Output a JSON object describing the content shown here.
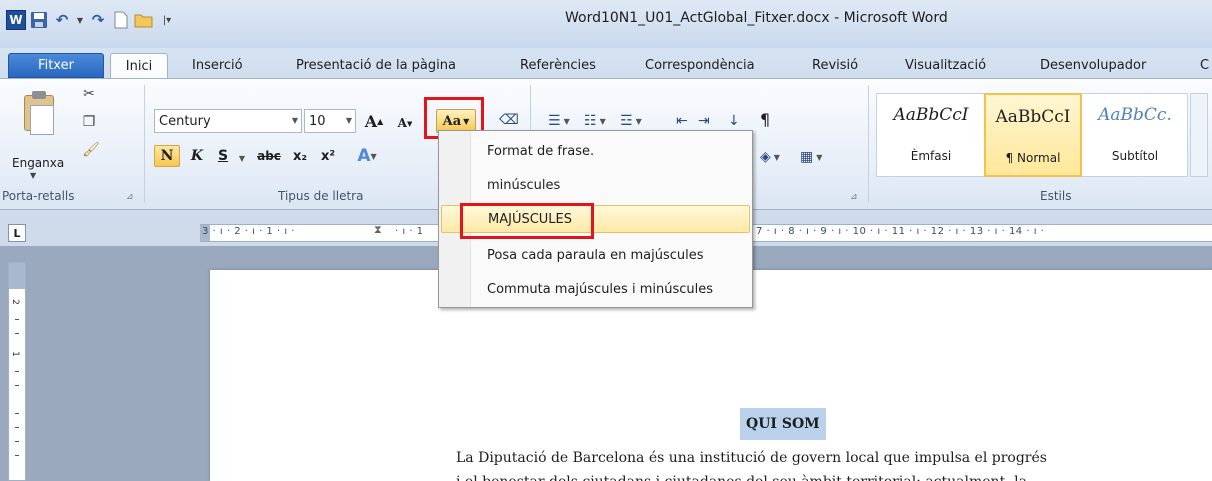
{
  "title_bar": {
    "title": "Word10N1_U01_ActGlobal_Fitxer.docx - Microsoft Word",
    "app_icon": "W"
  },
  "tabs": [
    {
      "label": "Fitxer"
    },
    {
      "label": "Inici"
    },
    {
      "label": "Inserció"
    },
    {
      "label": "Presentació de la pàgina"
    },
    {
      "label": "Referències"
    },
    {
      "label": "Correspondència"
    },
    {
      "label": "Revisió"
    },
    {
      "label": "Visualització"
    },
    {
      "label": "Desenvolupador"
    },
    {
      "label": "C"
    }
  ],
  "ribbon": {
    "clipboard": {
      "paste_label": "Enganxa",
      "group_label": "Porta-retalls"
    },
    "font": {
      "font_name": "Century",
      "font_size": "10",
      "group_label": "Tipus de lletra",
      "bold_label": "N",
      "italic_label": "K",
      "underline_label": "S",
      "strike_label": "abc",
      "subscript_label": "x₂",
      "superscript_label": "x²",
      "grow_label": "A",
      "shrink_label": "A",
      "change_case_label": "Aa"
    },
    "paragraph": {
      "pilcrow": "¶"
    },
    "styles": {
      "group_label": "Estils",
      "items": [
        {
          "sample": "AaBbCcI",
          "name": "Èmfasi"
        },
        {
          "sample": "AaBbCcI",
          "name": "¶ Normal"
        },
        {
          "sample": "AaBbCc.",
          "name": "Subtítol"
        }
      ]
    }
  },
  "change_case_menu": {
    "items": [
      {
        "label": "Format de frase."
      },
      {
        "label": "minúscules"
      },
      {
        "label": "MAJÚSCULES"
      },
      {
        "label": "Posa cada paraula en majúscules"
      },
      {
        "label": "Commuta majúscules i minúscules"
      }
    ]
  },
  "ruler": {
    "left_text": "3 · ı · 2 · ı · 1 · ı ·",
    "mid_text": "· ı · 1",
    "right_text": "7 · ı · 8 · ı · 9 · ı · 10 · ı · 11 · ı · 12 · ı · 13 · ı · 14 · ı ·",
    "corner": "L",
    "vertical_numbers": [
      "2",
      "1"
    ]
  },
  "document": {
    "heading": "QUI SOM",
    "line1": "La Diputació de Barcelona és una institució de govern local que impulsa el progrés",
    "line2": "i el benestar dels ciutadans i ciutadanes del seu àmbit territorial; actualment, la"
  },
  "colors": {
    "highlight_box": "#e2141c",
    "selection": "#b9d1ea",
    "file_tab": "#2a67c0"
  }
}
